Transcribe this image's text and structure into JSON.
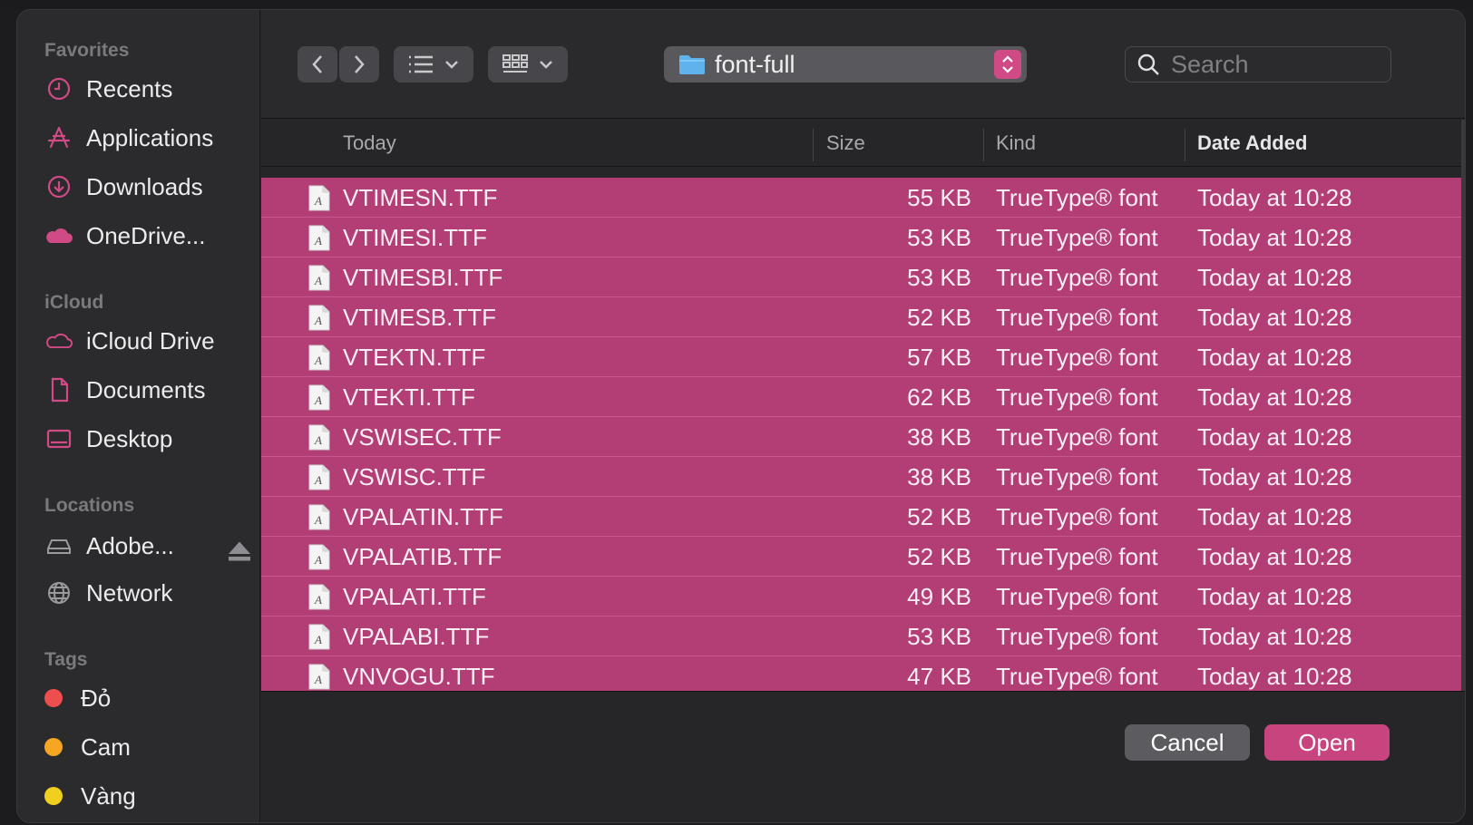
{
  "sidebar": {
    "favorites_label": "Favorites",
    "favorites": [
      {
        "label": "Recents",
        "icon": "clock-icon"
      },
      {
        "label": "Applications",
        "icon": "applications-icon"
      },
      {
        "label": "Downloads",
        "icon": "download-icon"
      },
      {
        "label": "OneDrive...",
        "icon": "cloud-filled-icon"
      }
    ],
    "icloud_label": "iCloud",
    "icloud": [
      {
        "label": "iCloud Drive",
        "icon": "cloud-icon"
      },
      {
        "label": "Documents",
        "icon": "document-icon"
      },
      {
        "label": "Desktop",
        "icon": "desktop-icon"
      }
    ],
    "locations_label": "Locations",
    "locations": [
      {
        "label": "Adobe...",
        "icon": "drive-icon"
      },
      {
        "label": "Network",
        "icon": "globe-icon"
      }
    ],
    "tags_label": "Tags",
    "tags": [
      {
        "label": "Đỏ",
        "color": "#ee4e4e"
      },
      {
        "label": "Cam",
        "color": "#f5a623"
      },
      {
        "label": "Vàng",
        "color": "#f0cf1f"
      }
    ]
  },
  "toolbar": {
    "path": "font-full",
    "search_placeholder": "Search",
    "accent": "#d04a86"
  },
  "table": {
    "headers": {
      "name": "Today",
      "size": "Size",
      "kind": "Kind",
      "date": "Date Added"
    },
    "rows": [
      {
        "name": "VTIMESN.TTF",
        "size": "55 KB",
        "kind": "TrueType® font",
        "date": "Today at 10:28"
      },
      {
        "name": "VTIMESI.TTF",
        "size": "53 KB",
        "kind": "TrueType® font",
        "date": "Today at 10:28"
      },
      {
        "name": "VTIMESBI.TTF",
        "size": "53 KB",
        "kind": "TrueType® font",
        "date": "Today at 10:28"
      },
      {
        "name": "VTIMESB.TTF",
        "size": "52 KB",
        "kind": "TrueType® font",
        "date": "Today at 10:28"
      },
      {
        "name": "VTEKTN.TTF",
        "size": "57 KB",
        "kind": "TrueType® font",
        "date": "Today at 10:28"
      },
      {
        "name": "VTEKTI.TTF",
        "size": "62 KB",
        "kind": "TrueType® font",
        "date": "Today at 10:28"
      },
      {
        "name": "VSWISEC.TTF",
        "size": "38 KB",
        "kind": "TrueType® font",
        "date": "Today at 10:28"
      },
      {
        "name": "VSWISC.TTF",
        "size": "38 KB",
        "kind": "TrueType® font",
        "date": "Today at 10:28"
      },
      {
        "name": "VPALATIN.TTF",
        "size": "52 KB",
        "kind": "TrueType® font",
        "date": "Today at 10:28"
      },
      {
        "name": "VPALATIB.TTF",
        "size": "52 KB",
        "kind": "TrueType® font",
        "date": "Today at 10:28"
      },
      {
        "name": "VPALATI.TTF",
        "size": "49 KB",
        "kind": "TrueType® font",
        "date": "Today at 10:28"
      },
      {
        "name": "VPALABI.TTF",
        "size": "53 KB",
        "kind": "TrueType® font",
        "date": "Today at 10:28"
      },
      {
        "name": "VNVOGU.TTF",
        "size": "47 KB",
        "kind": "TrueType® font",
        "date": "Today at 10:28"
      }
    ]
  },
  "buttons": {
    "cancel": "Cancel",
    "open": "Open"
  }
}
